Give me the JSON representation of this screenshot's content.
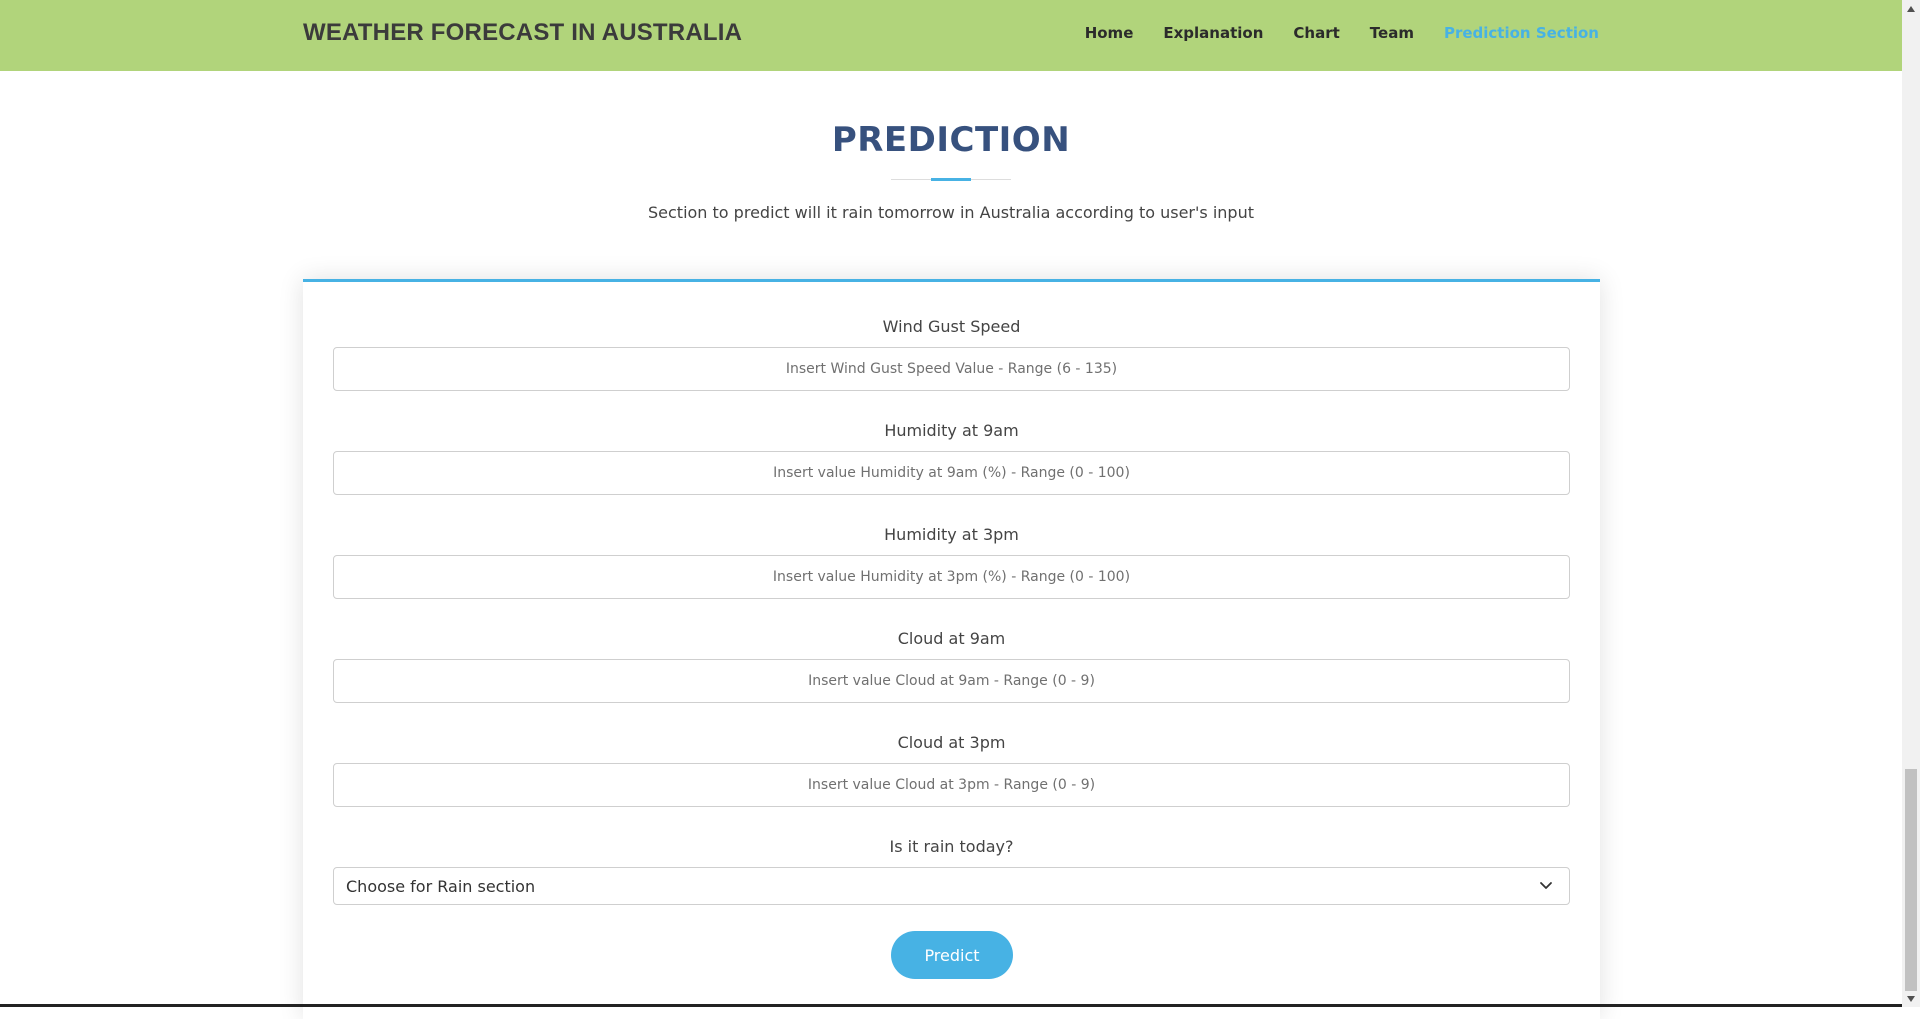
{
  "navbar": {
    "brand": "WEATHER FORECAST IN AUSTRALIA",
    "links": [
      {
        "label": "Home"
      },
      {
        "label": "Explanation"
      },
      {
        "label": "Chart"
      },
      {
        "label": "Team"
      },
      {
        "label": "Prediction Section",
        "active": true
      }
    ]
  },
  "section": {
    "title": "PREDICTION",
    "subtitle": "Section to predict will it rain tomorrow in Australia according to user's input"
  },
  "form": {
    "fields": [
      {
        "label": "Wind Gust Speed",
        "placeholder": "Insert Wind Gust Speed Value - Range (6 - 135)"
      },
      {
        "label": "Humidity at 9am",
        "placeholder": "Insert value Humidity at 9am (%) - Range (0 - 100)"
      },
      {
        "label": "Humidity at 3pm",
        "placeholder": "Insert value Humidity at 3pm (%) - Range (0 - 100)"
      },
      {
        "label": "Cloud at 9am",
        "placeholder": "Insert value Cloud at 9am - Range (0 - 9)"
      },
      {
        "label": "Cloud at 3pm",
        "placeholder": "Insert value Cloud at 3pm - Range (0 - 9)"
      }
    ],
    "rain_today": {
      "label": "Is it rain today?",
      "selected": "Choose for Rain section"
    },
    "submit_label": "Predict"
  },
  "colors": {
    "navbar_bg": "#b1d47b",
    "accent": "#47b2e4",
    "title": "#37517e"
  },
  "icons": {
    "select_arrow": "chevron-down-icon",
    "scroll_up": "scroll-up-arrow-icon",
    "scroll_down": "scroll-down-arrow-icon"
  }
}
